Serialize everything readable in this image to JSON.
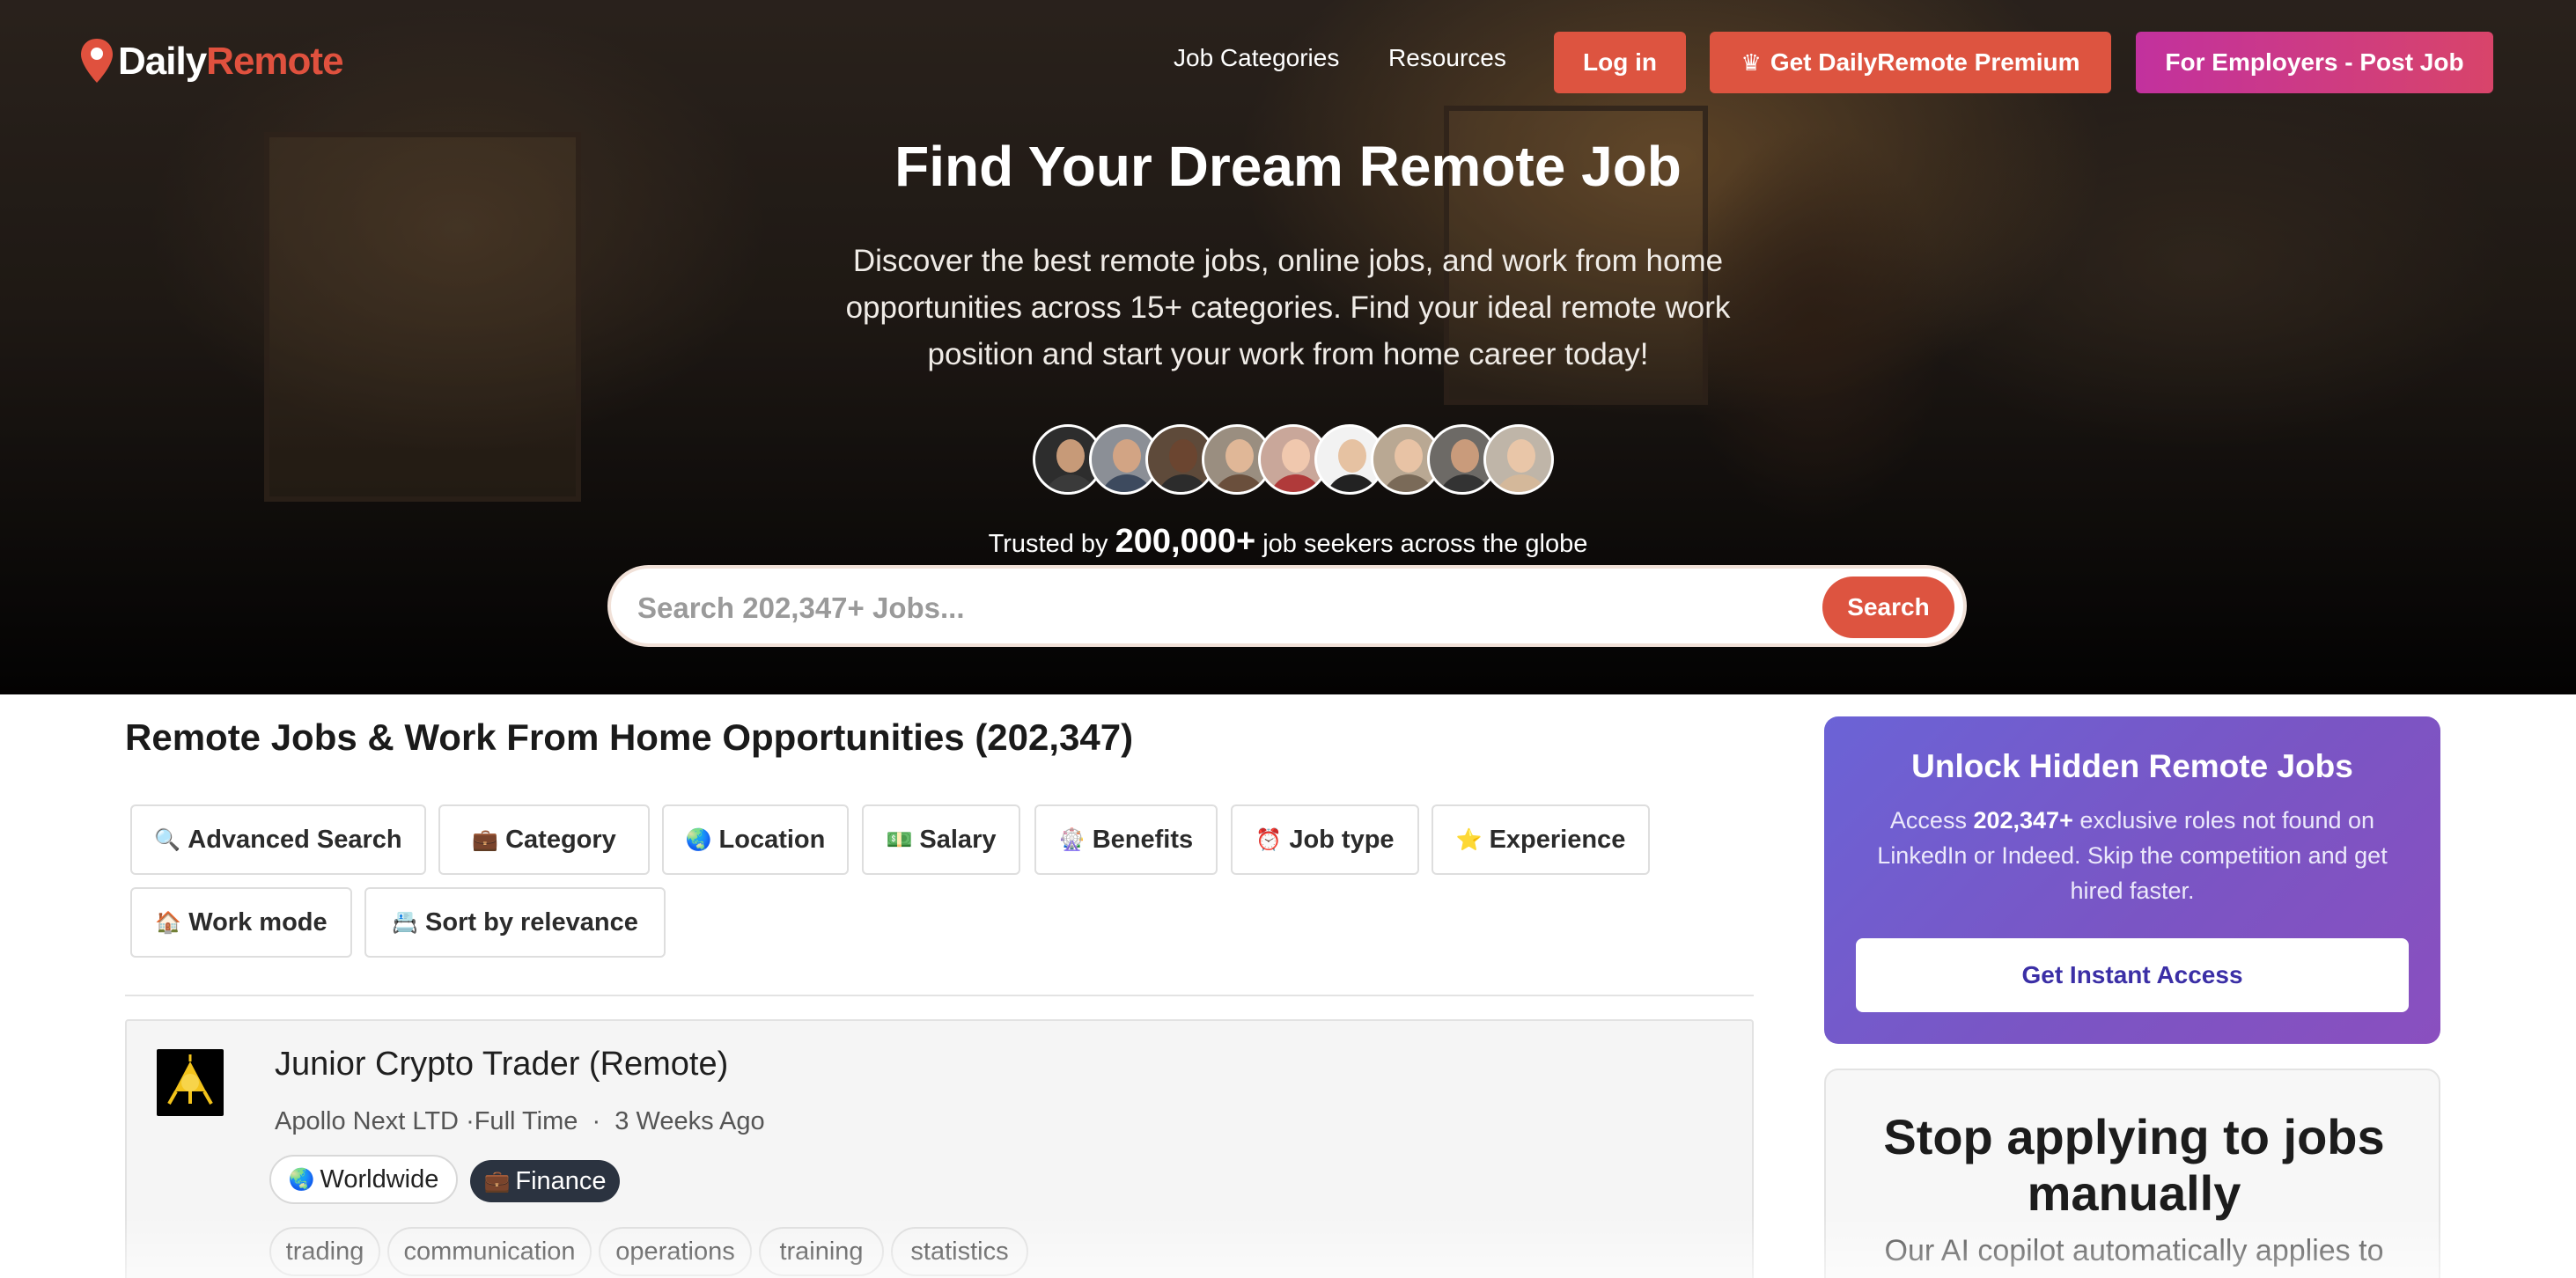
{
  "brand": {
    "name_part1": "Daily",
    "name_part2": "Remote",
    "colors": {
      "accent": "#dd5440",
      "employer_gradient_start": "#c2319e",
      "employer_gradient_end": "#d8446a",
      "promo": "#6b63d6"
    }
  },
  "nav": {
    "job_categories": "Job Categories",
    "resources": "Resources",
    "login": "Log in",
    "premium": "Get DailyRemote Premium",
    "employers": "For Employers - Post Job"
  },
  "hero": {
    "title": "Find Your Dream Remote Job",
    "subtitle": "Discover the best remote jobs, online jobs, and work from home opportunities across 15+ categories. Find your ideal remote work position and start your work from home career today!",
    "trusted_prefix": "Trusted by",
    "trusted_count": "200,000+",
    "trusted_suffix": "job seekers across the globe",
    "avatar_count": 9
  },
  "search": {
    "placeholder": "Search 202,347+ Jobs...",
    "button": "Search"
  },
  "main": {
    "title": "Remote Jobs & Work From Home Opportunities (202,347)",
    "filters": [
      {
        "icon": "🔍",
        "label": "Advanced Search"
      },
      {
        "icon": "💼",
        "label": "Category"
      },
      {
        "icon": "🌏",
        "label": "Location"
      },
      {
        "icon": "💵",
        "label": "Salary"
      },
      {
        "icon": "🎡",
        "label": "Benefits"
      },
      {
        "icon": "⏰",
        "label": "Job type"
      },
      {
        "icon": "⭐",
        "label": "Experience"
      },
      {
        "icon": "🏠",
        "label": "Work mode"
      },
      {
        "icon": "📇",
        "label": "Sort by relevance"
      }
    ],
    "job": {
      "title": "Junior Crypto Trader (Remote)",
      "company": "Apollo Next LTD",
      "type": "·Full Time",
      "sep": "·",
      "posted": "3 Weeks Ago",
      "location_icon": "🌏",
      "location": "Worldwide",
      "category_icon": "💼",
      "category": "Finance",
      "skills": [
        "trading",
        "communication",
        "operations",
        "training",
        "statistics"
      ]
    }
  },
  "sidebar": {
    "promo": {
      "title": "Unlock Hidden Remote Jobs",
      "text_prefix": "Access",
      "text_count": "202,347+",
      "text_suffix": "exclusive roles not found on LinkedIn or Indeed. Skip the competition and get hired faster.",
      "button": "Get Instant Access"
    },
    "copilot": {
      "title": "Stop applying to jobs manually",
      "text": "Our AI copilot automatically applies to"
    }
  }
}
